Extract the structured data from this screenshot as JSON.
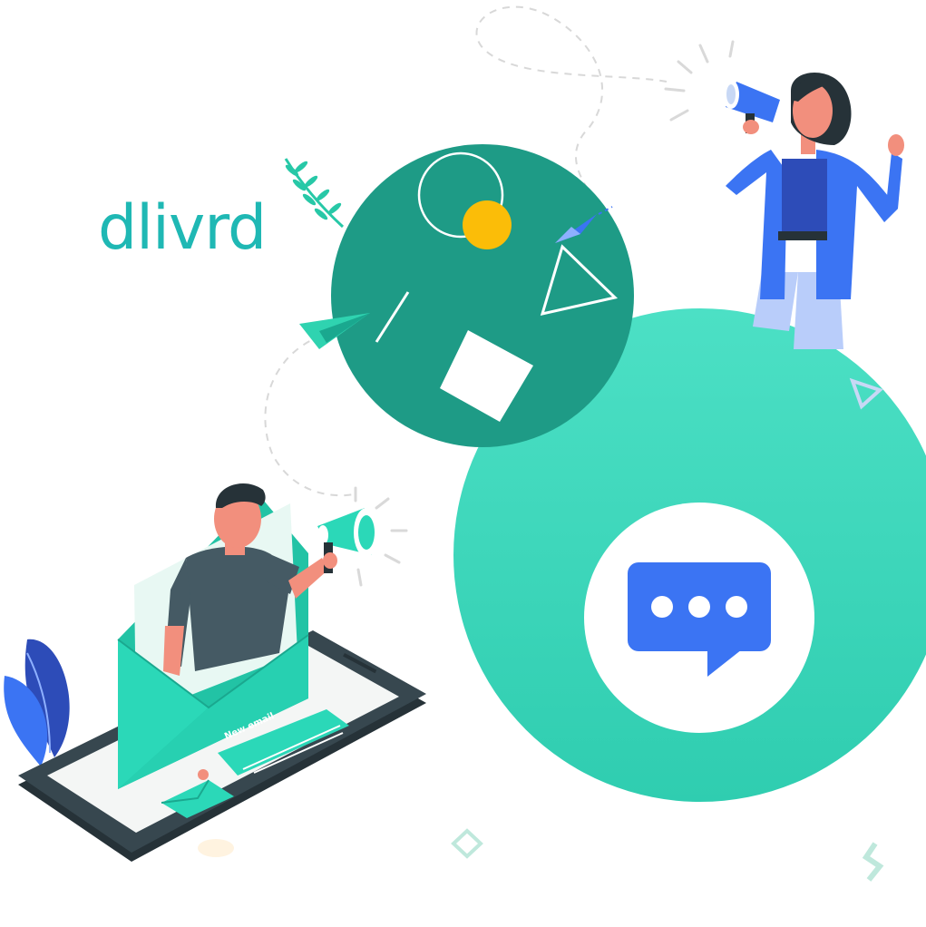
{
  "brand": {
    "name": "dlivrd",
    "color": "#1fb8b4"
  },
  "phone_card": {
    "label": "New email"
  },
  "colors": {
    "dark_circle": "#1e9b86",
    "mint_circle": "#3fd9bd",
    "accent_yellow": "#fbbd08",
    "chat_blue": "#3b74f3",
    "envelope": "#2bd8b8"
  },
  "icons": [
    "paper-plane-icon",
    "megaphone-icon",
    "chat-bubble-icon",
    "envelope-icon",
    "leaf-icon"
  ]
}
